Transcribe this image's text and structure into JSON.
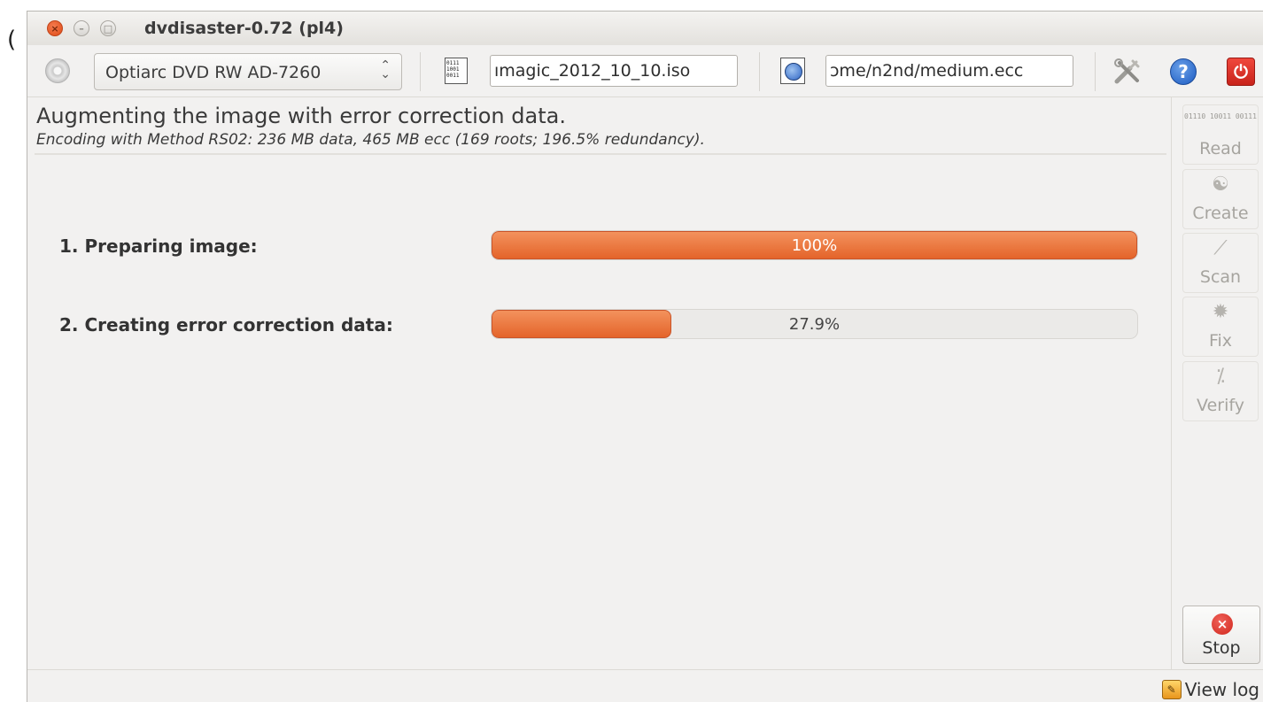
{
  "stray_char": "(",
  "window": {
    "title": "dvdisaster-0.72 (pl4)",
    "buttons": {
      "close": "×",
      "minimize": "–",
      "maximize": "□"
    }
  },
  "toolbar": {
    "drive": "Optiarc DVD RW AD-7260",
    "drive_arrows": "⌃⌄",
    "image_path": "ımagic_2012_10_10.iso",
    "ecc_path": "ɔme/n2nd/medium.ecc",
    "image_icon_text": "0111 1001 0011",
    "help_glyph": "?",
    "quit_glyph": "⏻",
    "icons": [
      "drive-icon",
      "image-file-icon",
      "ecc-file-icon",
      "preferences-tools-icon",
      "help-icon",
      "quit-icon"
    ]
  },
  "main": {
    "heading": "Augmenting the image with error correction data.",
    "subheading": "Encoding with Method RS02: 236 MB data, 465 MB ecc (169 roots; 196.5% redundancy).",
    "steps": [
      {
        "label": "1. Preparing image:",
        "progress_text": "100%",
        "progress": 1.0
      },
      {
        "label": "2. Creating error correction data:",
        "progress_text": "27.9%",
        "progress": 0.279
      }
    ]
  },
  "sidebar": {
    "read": {
      "label": "Read",
      "icon_text": "01110 10011 00111"
    },
    "create": {
      "label": "Create",
      "icon_glyph": "☯"
    },
    "scan": {
      "label": "Scan",
      "icon_glyph": "⟋"
    },
    "fix": {
      "label": "Fix",
      "icon_glyph": "✹"
    },
    "verify": {
      "label": "Verify",
      "icon_glyph": "⁒"
    },
    "stop": {
      "label": "Stop",
      "icon_glyph": "×"
    }
  },
  "statusbar": {
    "view_log": "View log",
    "log_icon_glyph": "✎"
  },
  "colors": {
    "progress_fill": "#e4642a",
    "window_bg": "#f2f1f0",
    "close_button": "#df4b16",
    "help_icon": "#1c5bc2",
    "quit_icon": "#c8231b"
  }
}
